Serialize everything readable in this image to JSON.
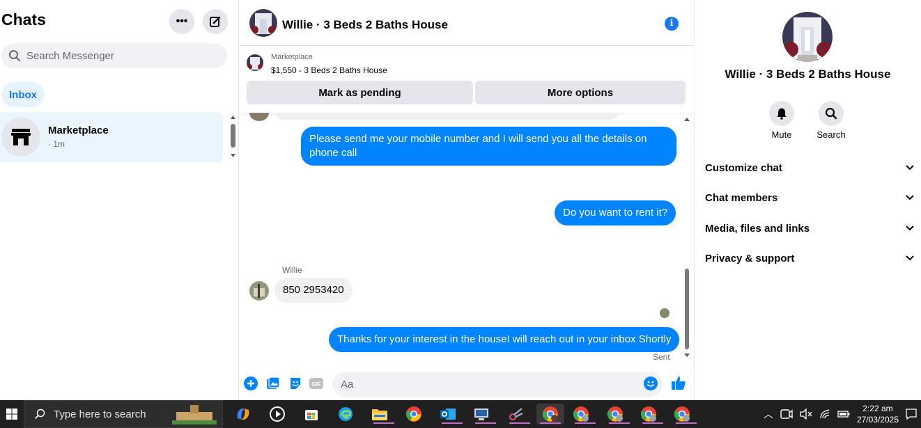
{
  "sidebar": {
    "title": "Chats",
    "search_placeholder": "Search Messenger",
    "filter_label": "Inbox",
    "chats": [
      {
        "name": "Marketplace",
        "time": "· 1m"
      }
    ]
  },
  "conversation": {
    "title": "Willie · 3 Beds 2 Baths House",
    "marketplace_label": "Marketplace",
    "listing": "$1,550 - 3 Beds 2 Baths House",
    "mark_pending_label": "Mark as pending",
    "more_options_label": "More options",
    "messages": [
      {
        "from": "me",
        "text": "Please send me your mobile number and I will send you all the details on phone call"
      },
      {
        "from": "me",
        "text": "Do you want to rent it?"
      },
      {
        "from": "Willie",
        "sender_label": "Willie",
        "text": "850 2953420"
      },
      {
        "from": "me",
        "text": "Thanks for your interest in the houseI will reach out in your inbox Shortly",
        "status": "Sent"
      }
    ],
    "composer_placeholder": "Aa",
    "accent": "#0084ff"
  },
  "details": {
    "title": "Willie · 3 Beds 2 Baths House",
    "actions": [
      {
        "label": "Mute",
        "icon": "bell-icon"
      },
      {
        "label": "Search",
        "icon": "search-icon"
      }
    ],
    "sections": [
      "Customize chat",
      "Chat members",
      "Media, files and links",
      "Privacy & support"
    ]
  },
  "taskbar": {
    "search_placeholder": "Type here to search",
    "time": "2:22 am",
    "date": "27/03/2025"
  }
}
